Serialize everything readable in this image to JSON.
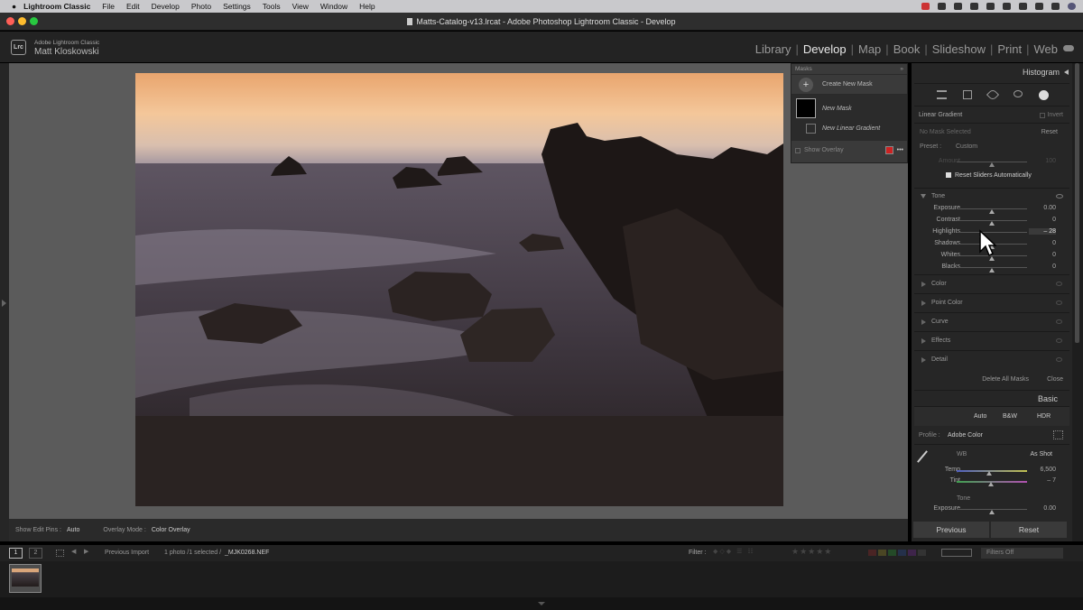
{
  "menubar": {
    "app": "Lightroom Classic",
    "items": [
      "File",
      "Edit",
      "Develop",
      "Photo",
      "Settings",
      "Tools",
      "View",
      "Window",
      "Help"
    ]
  },
  "window": {
    "title": "Matts-Catalog-v13.lrcat - Adobe Photoshop Lightroom Classic - Develop"
  },
  "identity": {
    "badge": "Lrc",
    "product": "Adobe Lightroom Classic",
    "user": "Matt Kloskowski"
  },
  "modules": [
    {
      "label": "Library"
    },
    {
      "label": "Develop",
      "active": true
    },
    {
      "label": "Map"
    },
    {
      "label": "Book"
    },
    {
      "label": "Slideshow"
    },
    {
      "label": "Print"
    },
    {
      "label": "Web"
    }
  ],
  "masks": {
    "title": "Masks",
    "create": "Create New Mask",
    "mask_name": "New Mask",
    "component": "New Linear Gradient",
    "show_overlay": "Show Overlay",
    "overlay_color": "#cc2222"
  },
  "toolbar": {
    "pins_label": "Show Edit Pins :",
    "pins_value": "Auto",
    "overlay_label": "Overlay Mode :",
    "overlay_value": "Color Overlay"
  },
  "panel": {
    "histogram": "Histogram",
    "mask_type": "Linear Gradient",
    "invert": "Invert",
    "no_mask": "No Mask Selected",
    "reset": "Reset",
    "preset_label": "Preset :",
    "preset_value": "Custom",
    "amount_label": "Amount",
    "amount_value": "100",
    "reset_sliders": "Reset Sliders Automatically",
    "tone": "Tone",
    "sliders": [
      {
        "label": "Exposure",
        "value": "0.00",
        "pos": 0.5
      },
      {
        "label": "Contrast",
        "value": "0",
        "pos": 0.5
      },
      {
        "label": "Highlights",
        "value": "– 28",
        "pos": 0.36
      },
      {
        "label": "Shadows",
        "value": "0",
        "pos": 0.5
      },
      {
        "label": "Whites",
        "value": "0",
        "pos": 0.5
      },
      {
        "label": "Blacks",
        "value": "0",
        "pos": 0.5
      }
    ],
    "sections": [
      "Color",
      "Point Color",
      "Curve",
      "Effects",
      "Detail"
    ],
    "delete_all": "Delete All Masks",
    "close": "Close",
    "basic": "Basic",
    "auto": "Auto",
    "bw": "B&W",
    "hdr": "HDR",
    "profile_label": "Profile :",
    "profile_value": "Adobe Color",
    "wb_label": "WB",
    "wb_value": "As Shot",
    "temp_label": "Temp",
    "temp_value": "6,500",
    "tint_label": "Tint",
    "tint_value": "– 7",
    "tone2": "Tone",
    "exposure2_label": "Exposure",
    "exposure2_value": "0.00",
    "previous": "Previous",
    "reset_btn": "Reset"
  },
  "filmbar": {
    "page1": "1",
    "page2": "2",
    "source": "Previous Import",
    "info": "1 photo /1 selected /",
    "file": "_MJK0268.NEF",
    "filter_label": "Filter :",
    "filters_off": "Filters Off"
  }
}
